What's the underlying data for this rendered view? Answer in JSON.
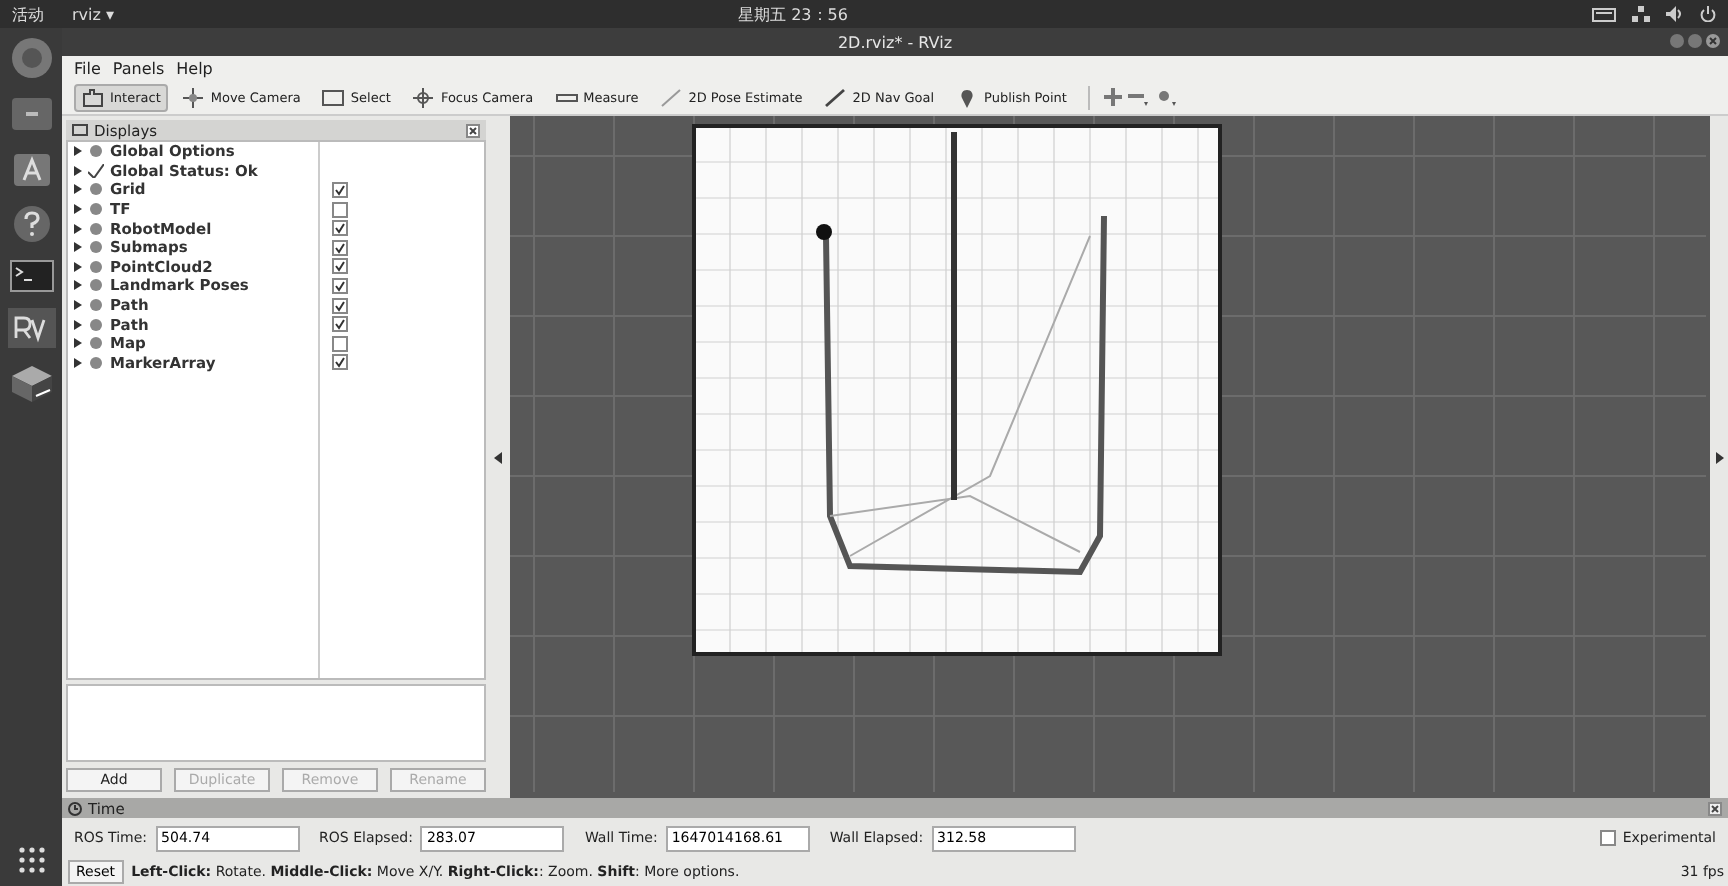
{
  "top_bar": {
    "activities": "活动",
    "app_menu": "rviz ▾",
    "clock": "星期五 23：56"
  },
  "window": {
    "title": "2D.rviz* - RViz"
  },
  "menu": [
    "File",
    "Panels",
    "Help"
  ],
  "toolbar": [
    {
      "label": "Interact",
      "selected": true
    },
    {
      "label": "Move Camera",
      "selected": false
    },
    {
      "label": "Select",
      "selected": false
    },
    {
      "label": "Focus Camera",
      "selected": false
    },
    {
      "label": "Measure",
      "selected": false
    },
    {
      "label": "2D Pose Estimate",
      "selected": false
    },
    {
      "label": "2D Nav Goal",
      "selected": false
    },
    {
      "label": "Publish Point",
      "selected": false
    }
  ],
  "displays": {
    "title": "Displays",
    "items": [
      {
        "kind": "option",
        "label": "Global Options"
      },
      {
        "kind": "option",
        "label": "Global Status: Ok"
      },
      {
        "kind": "display",
        "label": "Grid",
        "checked": true
      },
      {
        "kind": "display",
        "label": "TF",
        "checked": false
      },
      {
        "kind": "display",
        "label": "RobotModel",
        "checked": true
      },
      {
        "kind": "display",
        "label": "Submaps",
        "checked": true
      },
      {
        "kind": "display",
        "label": "PointCloud2",
        "checked": true
      },
      {
        "kind": "display",
        "label": "Landmark Poses",
        "checked": true
      },
      {
        "kind": "display",
        "label": "Path",
        "checked": true
      },
      {
        "kind": "display",
        "label": "Path",
        "checked": true
      },
      {
        "kind": "display",
        "label": "Map",
        "checked": false
      },
      {
        "kind": "display",
        "label": "MarkerArray",
        "checked": true
      }
    ],
    "buttons": [
      {
        "label": "Add",
        "disabled": false
      },
      {
        "label": "Duplicate",
        "disabled": true
      },
      {
        "label": "Remove",
        "disabled": true
      },
      {
        "label": "Rename",
        "disabled": true
      }
    ]
  },
  "time": {
    "title": "Time",
    "fields": [
      {
        "label": "ROS Time:",
        "value": "504.74"
      },
      {
        "label": "ROS Elapsed:",
        "value": "283.07"
      },
      {
        "label": "Wall Time:",
        "value": "1647014168.61"
      },
      {
        "label": "Wall Elapsed:",
        "value": "312.58"
      }
    ],
    "experimental": {
      "label": "Experimental",
      "checked": false
    }
  },
  "status_bar": {
    "reset": "Reset",
    "help": "**Left-Click:** Rotate. **Middle-Click:** Move X/Y. **Right-Click:**: Zoom. **Shift**: More options.",
    "fps": "31 fps"
  }
}
